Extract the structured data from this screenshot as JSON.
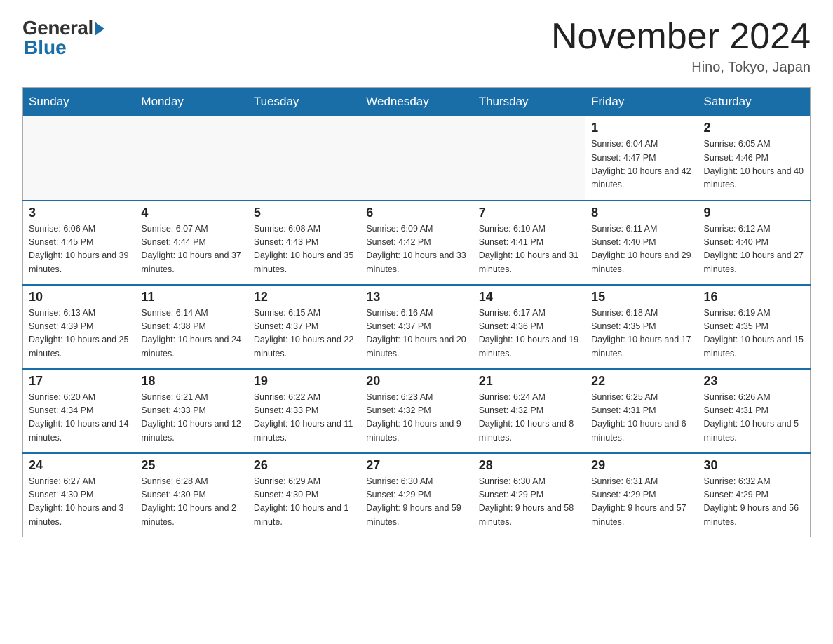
{
  "header": {
    "logo_general": "General",
    "logo_blue": "Blue",
    "month_title": "November 2024",
    "subtitle": "Hino, Tokyo, Japan"
  },
  "days_of_week": [
    "Sunday",
    "Monday",
    "Tuesday",
    "Wednesday",
    "Thursday",
    "Friday",
    "Saturday"
  ],
  "weeks": [
    [
      {
        "day": "",
        "info": ""
      },
      {
        "day": "",
        "info": ""
      },
      {
        "day": "",
        "info": ""
      },
      {
        "day": "",
        "info": ""
      },
      {
        "day": "",
        "info": ""
      },
      {
        "day": "1",
        "info": "Sunrise: 6:04 AM\nSunset: 4:47 PM\nDaylight: 10 hours and 42 minutes."
      },
      {
        "day": "2",
        "info": "Sunrise: 6:05 AM\nSunset: 4:46 PM\nDaylight: 10 hours and 40 minutes."
      }
    ],
    [
      {
        "day": "3",
        "info": "Sunrise: 6:06 AM\nSunset: 4:45 PM\nDaylight: 10 hours and 39 minutes."
      },
      {
        "day": "4",
        "info": "Sunrise: 6:07 AM\nSunset: 4:44 PM\nDaylight: 10 hours and 37 minutes."
      },
      {
        "day": "5",
        "info": "Sunrise: 6:08 AM\nSunset: 4:43 PM\nDaylight: 10 hours and 35 minutes."
      },
      {
        "day": "6",
        "info": "Sunrise: 6:09 AM\nSunset: 4:42 PM\nDaylight: 10 hours and 33 minutes."
      },
      {
        "day": "7",
        "info": "Sunrise: 6:10 AM\nSunset: 4:41 PM\nDaylight: 10 hours and 31 minutes."
      },
      {
        "day": "8",
        "info": "Sunrise: 6:11 AM\nSunset: 4:40 PM\nDaylight: 10 hours and 29 minutes."
      },
      {
        "day": "9",
        "info": "Sunrise: 6:12 AM\nSunset: 4:40 PM\nDaylight: 10 hours and 27 minutes."
      }
    ],
    [
      {
        "day": "10",
        "info": "Sunrise: 6:13 AM\nSunset: 4:39 PM\nDaylight: 10 hours and 25 minutes."
      },
      {
        "day": "11",
        "info": "Sunrise: 6:14 AM\nSunset: 4:38 PM\nDaylight: 10 hours and 24 minutes."
      },
      {
        "day": "12",
        "info": "Sunrise: 6:15 AM\nSunset: 4:37 PM\nDaylight: 10 hours and 22 minutes."
      },
      {
        "day": "13",
        "info": "Sunrise: 6:16 AM\nSunset: 4:37 PM\nDaylight: 10 hours and 20 minutes."
      },
      {
        "day": "14",
        "info": "Sunrise: 6:17 AM\nSunset: 4:36 PM\nDaylight: 10 hours and 19 minutes."
      },
      {
        "day": "15",
        "info": "Sunrise: 6:18 AM\nSunset: 4:35 PM\nDaylight: 10 hours and 17 minutes."
      },
      {
        "day": "16",
        "info": "Sunrise: 6:19 AM\nSunset: 4:35 PM\nDaylight: 10 hours and 15 minutes."
      }
    ],
    [
      {
        "day": "17",
        "info": "Sunrise: 6:20 AM\nSunset: 4:34 PM\nDaylight: 10 hours and 14 minutes."
      },
      {
        "day": "18",
        "info": "Sunrise: 6:21 AM\nSunset: 4:33 PM\nDaylight: 10 hours and 12 minutes."
      },
      {
        "day": "19",
        "info": "Sunrise: 6:22 AM\nSunset: 4:33 PM\nDaylight: 10 hours and 11 minutes."
      },
      {
        "day": "20",
        "info": "Sunrise: 6:23 AM\nSunset: 4:32 PM\nDaylight: 10 hours and 9 minutes."
      },
      {
        "day": "21",
        "info": "Sunrise: 6:24 AM\nSunset: 4:32 PM\nDaylight: 10 hours and 8 minutes."
      },
      {
        "day": "22",
        "info": "Sunrise: 6:25 AM\nSunset: 4:31 PM\nDaylight: 10 hours and 6 minutes."
      },
      {
        "day": "23",
        "info": "Sunrise: 6:26 AM\nSunset: 4:31 PM\nDaylight: 10 hours and 5 minutes."
      }
    ],
    [
      {
        "day": "24",
        "info": "Sunrise: 6:27 AM\nSunset: 4:30 PM\nDaylight: 10 hours and 3 minutes."
      },
      {
        "day": "25",
        "info": "Sunrise: 6:28 AM\nSunset: 4:30 PM\nDaylight: 10 hours and 2 minutes."
      },
      {
        "day": "26",
        "info": "Sunrise: 6:29 AM\nSunset: 4:30 PM\nDaylight: 10 hours and 1 minute."
      },
      {
        "day": "27",
        "info": "Sunrise: 6:30 AM\nSunset: 4:29 PM\nDaylight: 9 hours and 59 minutes."
      },
      {
        "day": "28",
        "info": "Sunrise: 6:30 AM\nSunset: 4:29 PM\nDaylight: 9 hours and 58 minutes."
      },
      {
        "day": "29",
        "info": "Sunrise: 6:31 AM\nSunset: 4:29 PM\nDaylight: 9 hours and 57 minutes."
      },
      {
        "day": "30",
        "info": "Sunrise: 6:32 AM\nSunset: 4:29 PM\nDaylight: 9 hours and 56 minutes."
      }
    ]
  ]
}
